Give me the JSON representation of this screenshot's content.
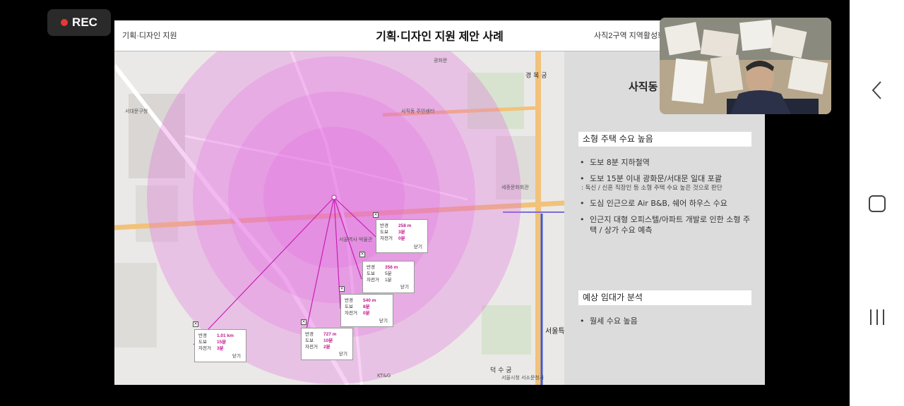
{
  "recording": {
    "label": "REC"
  },
  "slide": {
    "header": {
      "left": "기획·디자인 지원",
      "title": "기획·디자인 지원 제안 사례",
      "right": "사직2구역 지역활성화"
    },
    "panel": {
      "heading": "사직동",
      "section1": {
        "title": "소형 주택 수요 높음",
        "bullets": [
          "도보 8분 지하철역",
          "도보 15분 이내 광화문/서대문 일대 포괄",
          "도심 인근으로 Air B&B, 쉐어 하우스 수요",
          "인근지 대형 오피스텔/아파트 개발로 인한 소형 주택 / 상가 수요 예측"
        ],
        "sub_note": ": 독신 / 신혼 직장인 등 소형 주택 수요 높은 것으로 판단"
      },
      "section2": {
        "title": "예상 임대가 분석",
        "bullets": [
          "월세 수요 높음"
        ]
      }
    },
    "map": {
      "callouts": [
        {
          "radius_label": "반경",
          "radius": "258 m",
          "walk_label": "도보",
          "walk": "3분",
          "bike_label": "자전거",
          "bike": "0분",
          "close": "닫기"
        },
        {
          "radius_label": "반경",
          "radius": "356 m",
          "walk_label": "도보",
          "walk": "5분",
          "bike_label": "자전거",
          "bike": "1분",
          "close": "닫기"
        },
        {
          "radius_label": "반경",
          "radius": "540 m",
          "walk_label": "도보",
          "walk": "8분",
          "bike_label": "자전거",
          "bike": "0분",
          "close": "닫기"
        },
        {
          "radius_label": "반경",
          "radius": "727 m",
          "walk_label": "도보",
          "walk": "10분",
          "bike_label": "자전거",
          "bike": "2분",
          "close": "닫기"
        },
        {
          "radius_label": "반경",
          "radius": "1.01 km",
          "walk_label": "도보",
          "walk": "15분",
          "bike_label": "자전거",
          "bike": "3분",
          "close": "닫기"
        }
      ],
      "labels": {
        "gyeongbok": "경 복 궁",
        "gwanghwamun": "광화문",
        "seoul_station": "서울특",
        "deoksugung": "덕 수 궁",
        "city_hall": "서울시청 서소문청사",
        "sajik_center": "사직동 주민센터",
        "seodaemun_office": "서대문구청",
        "seoul_museum": "서울역사 박물관",
        "kbs": "KT&G",
        "sejong": "세종문화회관"
      }
    }
  },
  "android_nav": {
    "back_icon": "chevron-left-icon",
    "home_icon": "rounded-square-icon",
    "recents_icon": "three-bars-icon"
  }
}
